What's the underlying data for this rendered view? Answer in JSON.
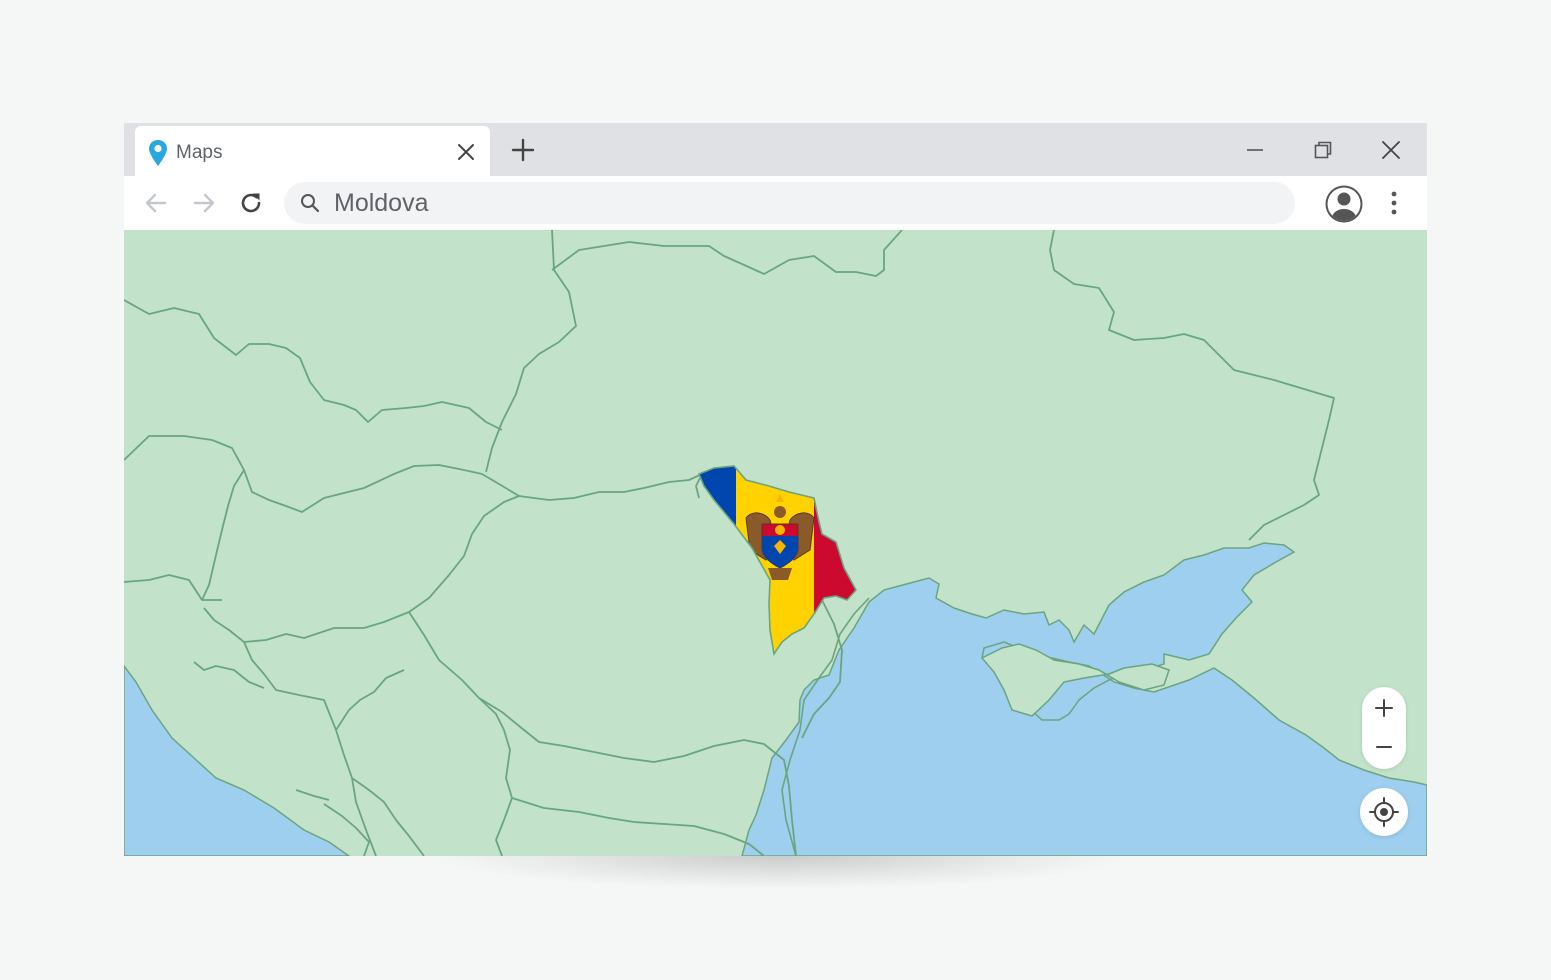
{
  "tab": {
    "title": "Maps",
    "icon": "map-pin-icon",
    "icon_color": "#29a8e0"
  },
  "toolbar": {
    "back_icon": "arrow-left-icon",
    "forward_icon": "arrow-right-icon",
    "reload_icon": "reload-icon",
    "search_icon": "search-icon",
    "search_value": "Moldova",
    "profile_icon": "account-circle-icon",
    "menu_icon": "more-vertical-icon"
  },
  "window_controls": {
    "minimize_icon": "minimize-icon",
    "restore_icon": "restore-icon",
    "close_icon": "close-icon",
    "new_tab_icon": "plus-icon"
  },
  "map": {
    "land_color": "#c2e3c9",
    "water_color": "#9ecfee",
    "border_color": "#6aa57f",
    "highlighted_country_flag": [
      "#0046ae",
      "#ffd200",
      "#cc092f"
    ],
    "zoom_in_icon": "plus-icon",
    "zoom_out_icon": "minus-icon",
    "locate_icon": "crosshair-icon"
  }
}
